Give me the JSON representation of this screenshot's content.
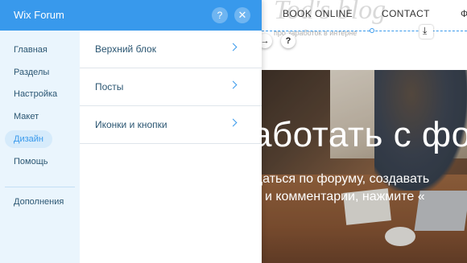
{
  "panel": {
    "title": "Wix Forum",
    "help_glyph": "?",
    "close_glyph": "✕"
  },
  "sidebar": {
    "items": [
      {
        "label": "Главная",
        "active": false
      },
      {
        "label": "Разделы",
        "active": false
      },
      {
        "label": "Настройка",
        "active": false
      },
      {
        "label": "Макет",
        "active": false
      },
      {
        "label": "Дизайн",
        "active": true
      },
      {
        "label": "Помощь",
        "active": false
      }
    ],
    "extras": [
      {
        "label": "Дополнения"
      }
    ]
  },
  "design_menu": {
    "rows": [
      {
        "label": "Верхний блок"
      },
      {
        "label": "Посты"
      },
      {
        "label": "Иконки и кнопки"
      }
    ]
  },
  "site": {
    "nav": [
      "BOOK ONLINE",
      "CONTACT",
      "Ф"
    ],
    "watermark": "Tod's blog",
    "watermark_sub": "про заработок в интерне",
    "hero_title": "аботать с фо",
    "hero_sub_1": "щаться по форуму, создавать",
    "hero_sub_2": "ы и комментарии, нажмите «",
    "arrow_glyph": "→",
    "help_glyph": "?",
    "download_glyph": "⤓"
  },
  "colors": {
    "accent": "#3899ec",
    "sidebar_bg": "#eaf5fd",
    "text_dark": "#2b5672"
  }
}
